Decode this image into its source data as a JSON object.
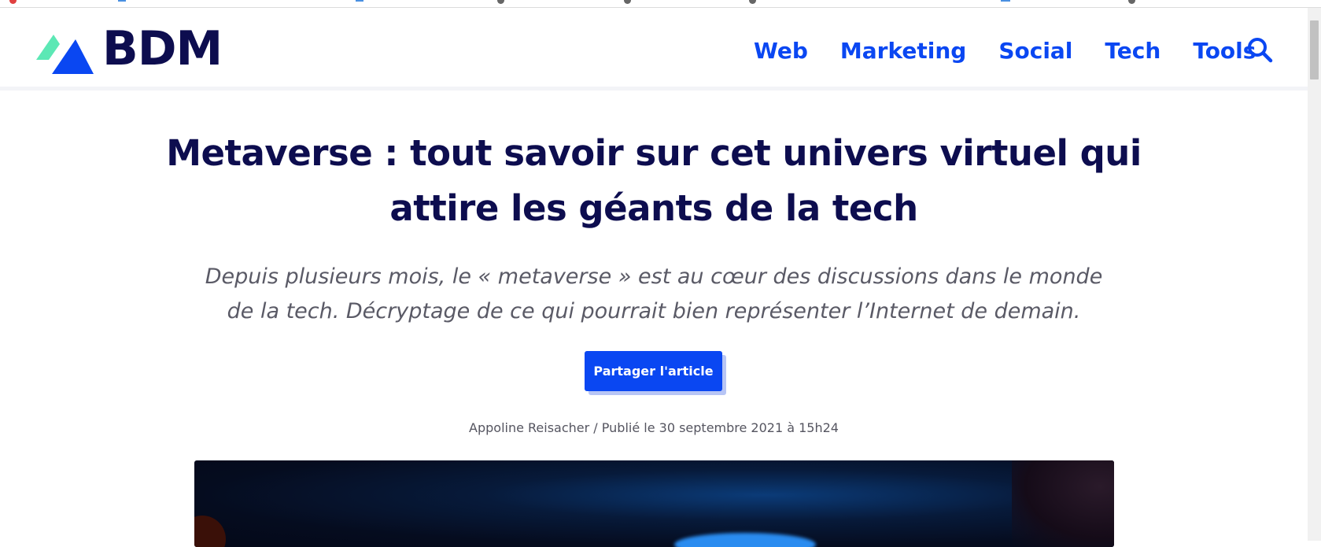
{
  "site": {
    "logo_text": "BDM",
    "logo_icon": "bdm-mountain-logo"
  },
  "nav": {
    "items": [
      {
        "label": "Web"
      },
      {
        "label": "Marketing"
      },
      {
        "label": "Social"
      },
      {
        "label": "Tech"
      },
      {
        "label": "Tools"
      }
    ],
    "search_icon": "search-icon"
  },
  "article": {
    "title": "Metaverse : tout savoir sur cet univers virtuel qui attire les géants de la tech",
    "subtitle": "Depuis plusieurs mois, le « metaverse » est au cœur des discussions dans le monde de la tech. Décryptage de ce qui pourrait bien représenter l’Internet de demain.",
    "share_label": "Partager l'article",
    "meta": "Appoline Reisacher / Publié le 30 septembre 2021 à 15h24"
  },
  "colors": {
    "brand_blue": "#0a47f2",
    "dark_navy": "#0d0d4f",
    "logo_green": "#5ce8b5",
    "text_gray": "#555560"
  }
}
